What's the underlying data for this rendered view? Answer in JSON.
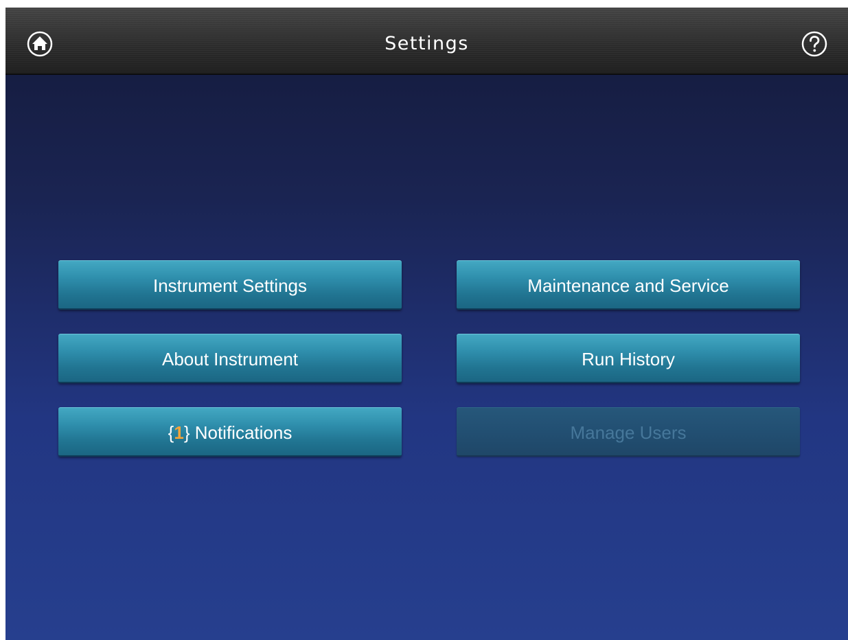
{
  "header": {
    "title": "Settings",
    "home_icon": "home-icon",
    "help_icon": "help-icon"
  },
  "menu": {
    "instrument_settings": "Instrument Settings",
    "maintenance_and_service": "Maintenance and Service",
    "about_instrument": "About Instrument",
    "run_history": "Run History",
    "notifications": {
      "open_brace": "{",
      "count": "1",
      "close_brace": "}",
      "label": " Notifications"
    },
    "manage_users": "Manage Users",
    "manage_users_enabled": false
  },
  "colors": {
    "button_accent": "#2f8fad",
    "notification_count": "#f2a43a",
    "disabled_text": "#46779a",
    "background_top": "#141a3a",
    "background_bottom": "#263f8e"
  }
}
